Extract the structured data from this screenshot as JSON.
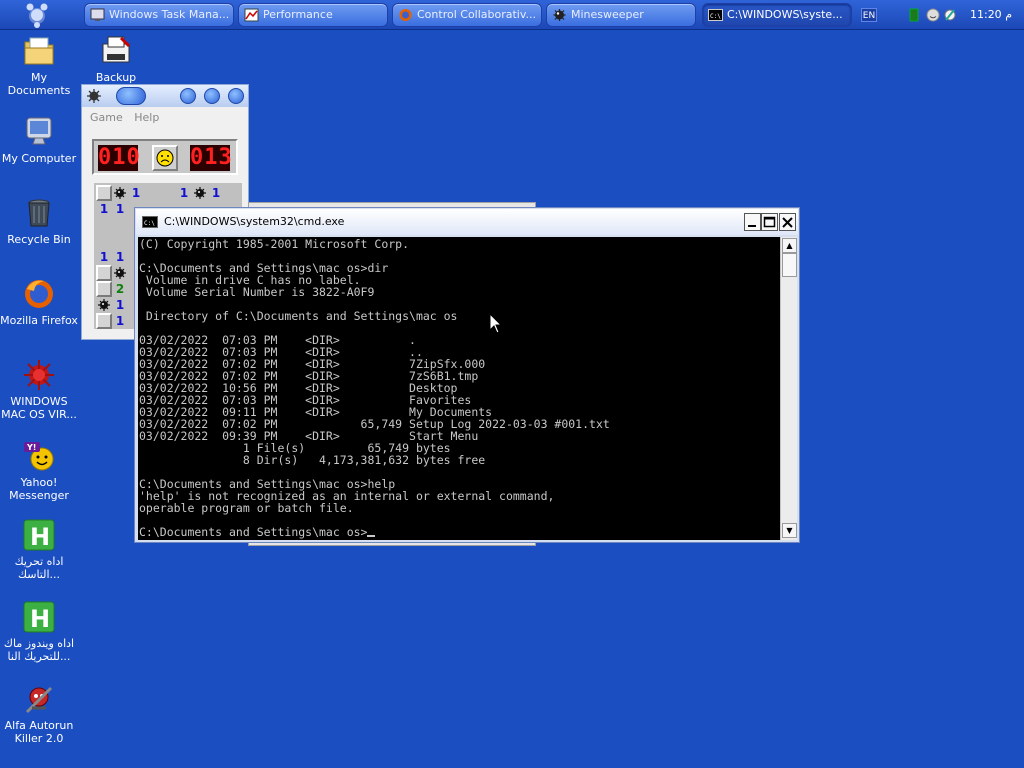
{
  "taskbar": {
    "buttons": [
      {
        "label": "Windows Task Mana...",
        "icon": "task-manager-icon"
      },
      {
        "label": "Performance",
        "icon": "performance-icon"
      },
      {
        "label": "Control Collaborativ...",
        "icon": "firefox-icon"
      },
      {
        "label": "Minesweeper",
        "icon": "minesweeper-icon"
      },
      {
        "label": "C:\\WINDOWS\\syste...",
        "icon": "cmd-icon"
      }
    ],
    "language": "EN",
    "clock": "11:20 م"
  },
  "desktop": {
    "icons": [
      {
        "label": "My Documents"
      },
      {
        "label": "My Computer"
      },
      {
        "label": "Recycle Bin"
      },
      {
        "label": "Mozilla Firefox"
      },
      {
        "label": "WINDOWS MAC OS VIR..."
      },
      {
        "label": "Yahoo! Messenger"
      },
      {
        "label": "اداه تحريك التاسك..."
      },
      {
        "label": "اداه ويندوز ماك للتحريك النا..."
      },
      {
        "label": "Alfa Autorun Killer 2.0"
      },
      {
        "label": "Backup"
      }
    ]
  },
  "minesweeper": {
    "menu": {
      "game": "Game",
      "help": "Help"
    },
    "mine_counter": "010",
    "timer": "013",
    "cells": [
      {
        "t": "1",
        "c": "n1"
      },
      {
        "t": "1",
        "c": "n1"
      },
      {
        "t": "1",
        "c": "n1"
      },
      {
        "t": "1",
        "c": "n1"
      },
      {
        "t": "1",
        "c": "n1"
      },
      {
        "t": "1",
        "c": "n1"
      },
      {
        "t": "1",
        "c": "n1"
      },
      {
        "t": "2",
        "c": "n2"
      },
      {
        "t": "1",
        "c": "n1"
      },
      {
        "t": "1",
        "c": "n1"
      }
    ]
  },
  "cmd": {
    "title": "C:\\WINDOWS\\system32\\cmd.exe",
    "lines": [
      "(C) Copyright 1985-2001 Microsoft Corp.",
      "",
      "C:\\Documents and Settings\\mac os>dir",
      " Volume in drive C has no label.",
      " Volume Serial Number is 3822-A0F9",
      "",
      " Directory of C:\\Documents and Settings\\mac os",
      "",
      "03/02/2022  07:03 PM    <DIR>          .",
      "03/02/2022  07:03 PM    <DIR>          ..",
      "03/02/2022  07:02 PM    <DIR>          7ZipSfx.000",
      "03/02/2022  07:02 PM    <DIR>          7zS6B1.tmp",
      "03/02/2022  10:56 PM    <DIR>          Desktop",
      "03/02/2022  07:03 PM    <DIR>          Favorites",
      "03/02/2022  09:11 PM    <DIR>          My Documents",
      "03/02/2022  07:02 PM            65,749 Setup Log 2022-03-03 #001.txt",
      "03/02/2022  09:39 PM    <DIR>          Start Menu",
      "               1 File(s)         65,749 bytes",
      "               8 Dir(s)   4,173,381,632 bytes free",
      "",
      "C:\\Documents and Settings\\mac os>help",
      "'help' is not recognized as an internal or external command,",
      "operable program or batch file.",
      "",
      "C:\\Documents and Settings\\mac os>"
    ]
  }
}
